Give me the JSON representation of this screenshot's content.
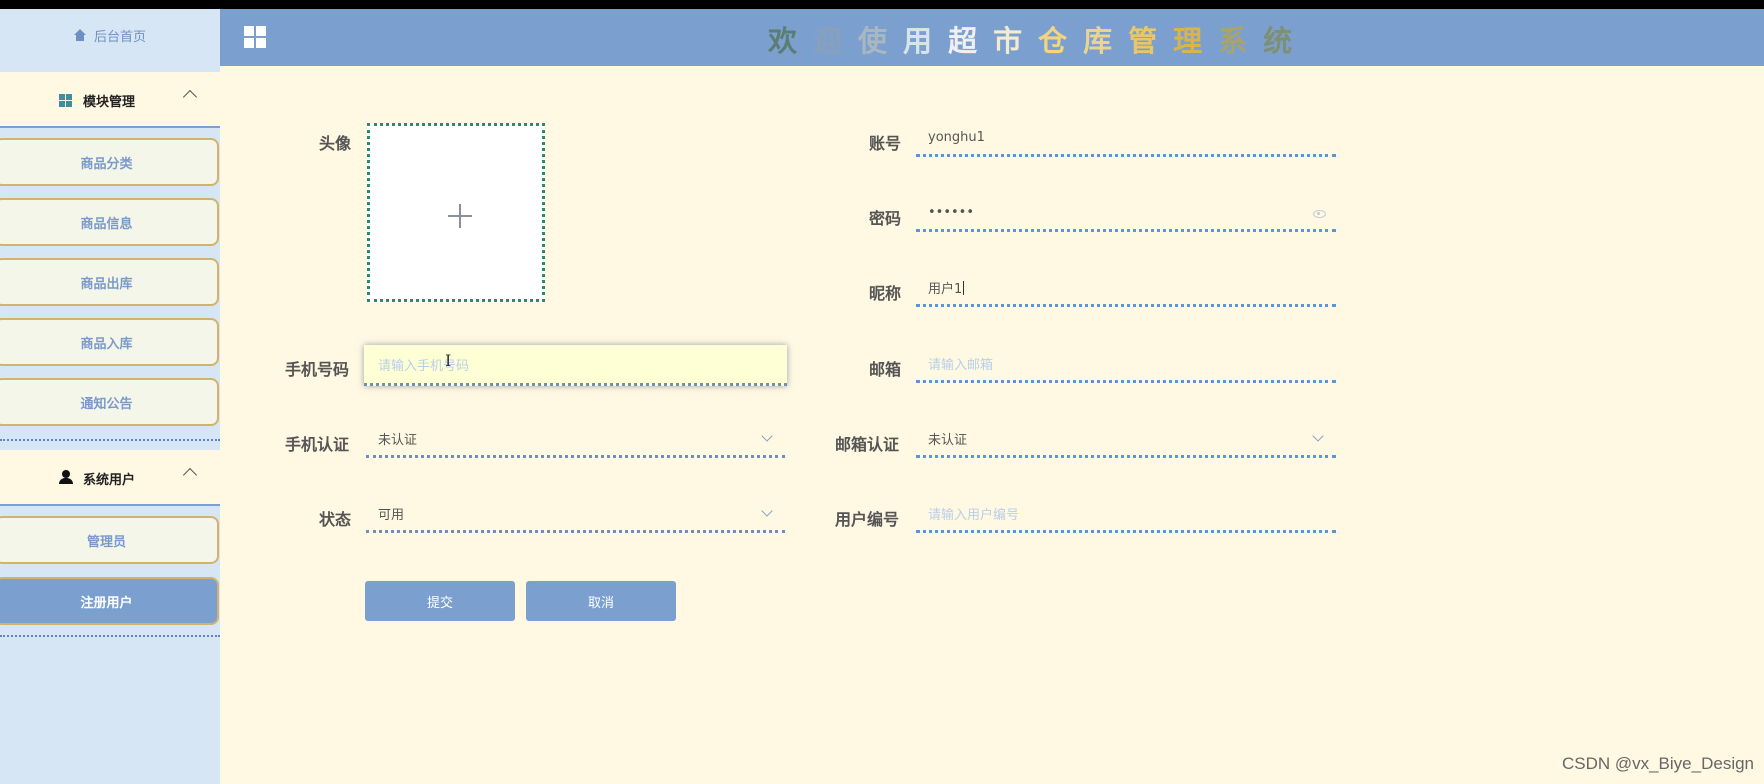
{
  "header": {
    "title_chars": [
      "欢",
      "迎",
      "使",
      "用",
      "超",
      "市",
      "仓",
      "库",
      "管",
      "理",
      "系",
      "统"
    ]
  },
  "sidebar": {
    "home_label": "后台首页",
    "groups": [
      {
        "label": "模块管理",
        "items": [
          {
            "label": "商品分类"
          },
          {
            "label": "商品信息"
          },
          {
            "label": "商品出库"
          },
          {
            "label": "商品入库"
          },
          {
            "label": "通知公告"
          }
        ]
      },
      {
        "label": "系统用户",
        "items": [
          {
            "label": "管理员"
          },
          {
            "label": "注册用户"
          }
        ]
      }
    ]
  },
  "form": {
    "avatar_label": "头像",
    "account_label": "账号",
    "account_value": "yonghu1",
    "password_label": "密码",
    "password_value": "••••••",
    "nickname_label": "昵称",
    "nickname_value": "用户1",
    "phone_label": "手机号码",
    "phone_placeholder": "请输入手机号码",
    "email_label": "邮箱",
    "email_placeholder": "请输入邮箱",
    "phone_verify_label": "手机认证",
    "phone_verify_value": "未认证",
    "email_verify_label": "邮箱认证",
    "email_verify_value": "未认证",
    "status_label": "状态",
    "status_value": "可用",
    "user_no_label": "用户编号",
    "user_no_placeholder": "请输入用户编号",
    "submit_label": "提交",
    "cancel_label": "取消"
  },
  "watermark": "CSDN @vx_Biye_Design",
  "colors": {
    "header_bg": "#7ba0d0",
    "sidebar_bg": "#d6e6f4",
    "page_bg": "#fff9e3",
    "button_bg": "#7ba0d0",
    "menu_border": "#d2b36b"
  }
}
